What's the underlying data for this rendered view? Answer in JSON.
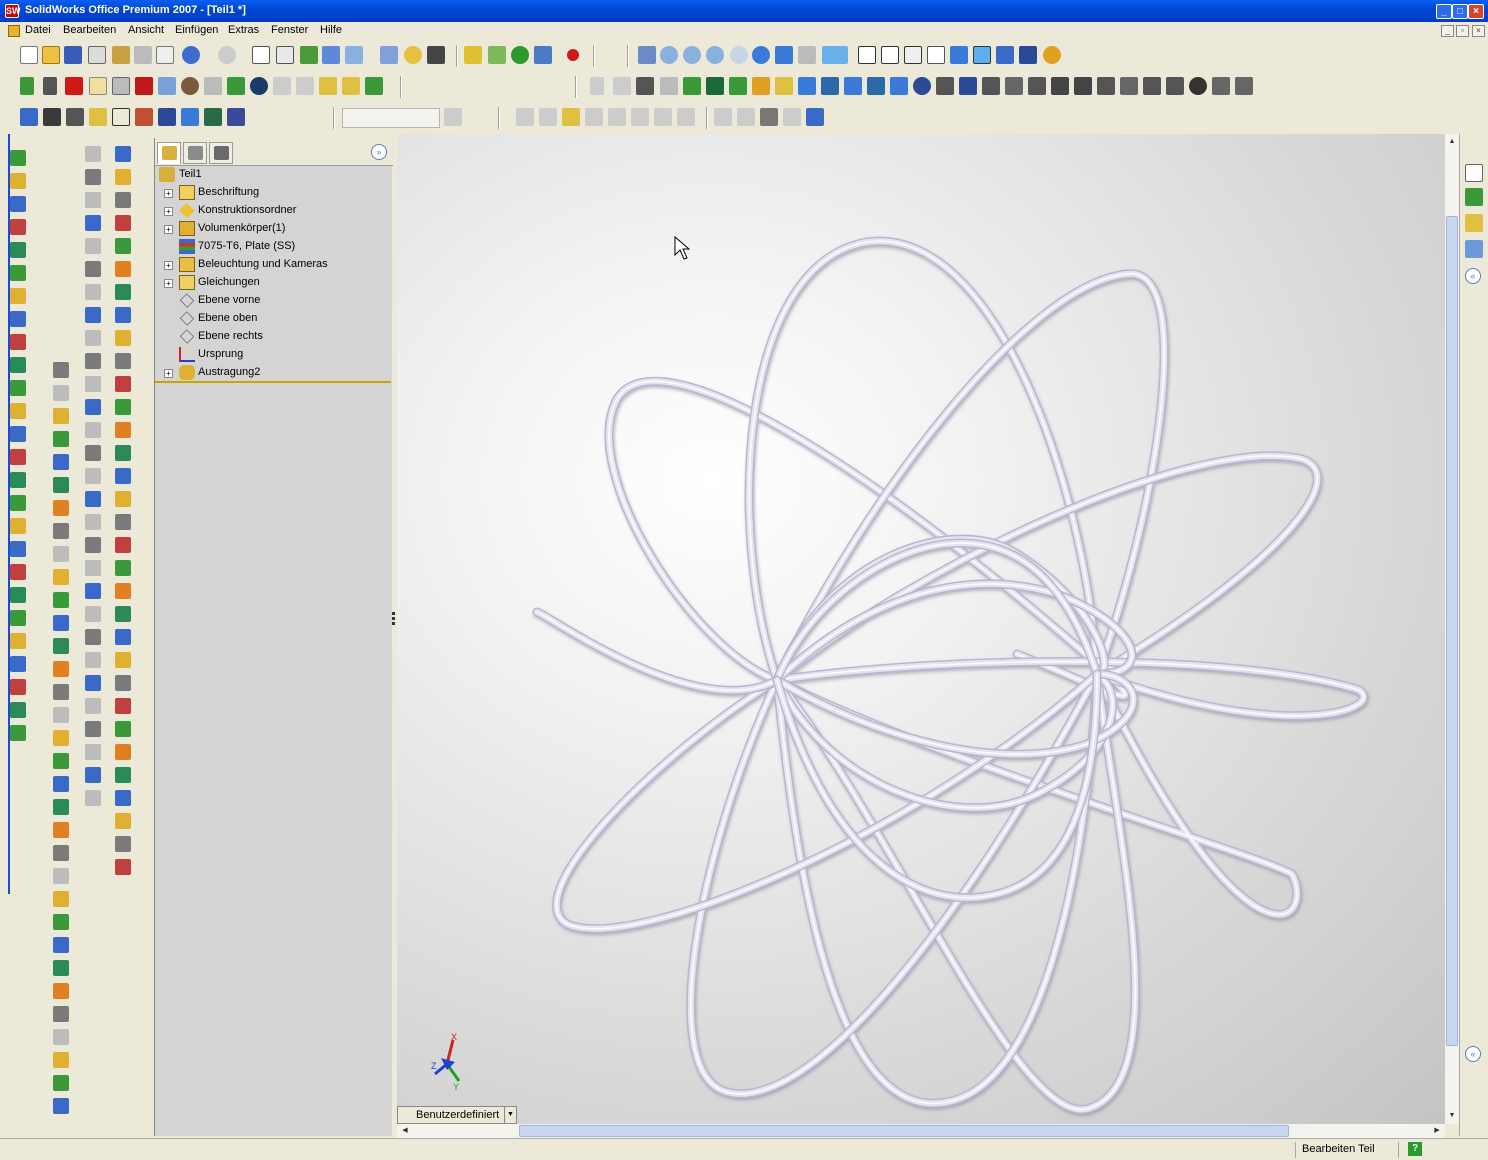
{
  "window": {
    "title": "SolidWorks Office Premium 2007 - [Teil1 *]",
    "app_icon": "SW",
    "buttons": [
      "minimize",
      "maximize",
      "close"
    ]
  },
  "menubar": {
    "items": [
      "Datei",
      "Bearbeiten",
      "Ansicht",
      "Einfügen",
      "Extras",
      "Fenster",
      "Hilfe"
    ]
  },
  "feature_manager": {
    "tabs": [
      "featuremanager-tab",
      "propertymanager-tab",
      "configurationmanager-tab"
    ],
    "root": "Teil1",
    "items": [
      {
        "label": "Beschriftung",
        "expandable": true,
        "icon": "annotations-icon"
      },
      {
        "label": "Konstruktionsordner",
        "expandable": true,
        "icon": "design-folder-icon"
      },
      {
        "label": "Volumenkörper(1)",
        "expandable": true,
        "icon": "solid-bodies-icon"
      },
      {
        "label": "7075-T6, Plate (SS)",
        "expandable": false,
        "icon": "material-icon"
      },
      {
        "label": "Beleuchtung und Kameras",
        "expandable": true,
        "icon": "lights-cameras-icon"
      },
      {
        "label": "Gleichungen",
        "expandable": true,
        "icon": "equations-icon"
      },
      {
        "label": "Ebene vorne",
        "expandable": false,
        "icon": "plane-icon"
      },
      {
        "label": "Ebene oben",
        "expandable": false,
        "icon": "plane-icon"
      },
      {
        "label": "Ebene rechts",
        "expandable": false,
        "icon": "plane-icon"
      },
      {
        "label": "Ursprung",
        "expandable": false,
        "icon": "origin-icon"
      },
      {
        "label": "Austragung2",
        "expandable": true,
        "icon": "sweep-icon"
      }
    ]
  },
  "viewport": {
    "view_orientation": "Benutzerdefiniert",
    "triad_labels": [
      "X",
      "Y",
      "Z"
    ],
    "model_color": "#e4e4f0"
  },
  "statusbar": {
    "text": "Bearbeiten Teil",
    "help_icon": "?"
  }
}
